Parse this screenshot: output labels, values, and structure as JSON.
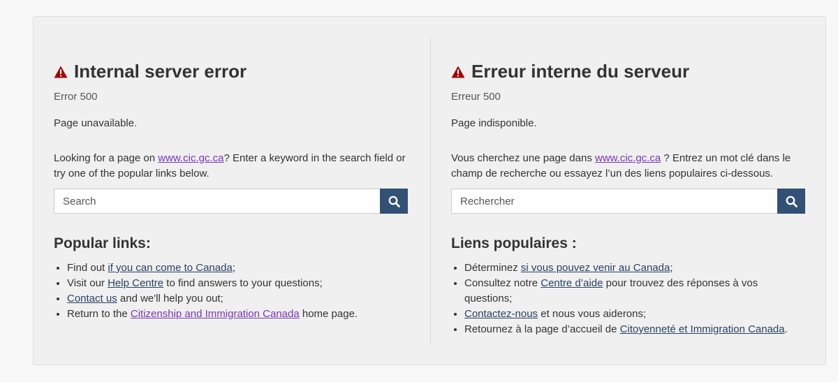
{
  "en": {
    "title": "Internal server error",
    "code": "Error 500",
    "unavailable": "Page unavailable.",
    "intro_before": "Looking for a page on ",
    "intro_link": "www.cic.gc.ca",
    "intro_after": "? Enter a keyword in the search field or try one of the popular links below.",
    "search_placeholder": "Search",
    "popular_heading": "Popular links:",
    "links": [
      {
        "before": "Find out ",
        "link": "if you can come to Canada",
        "after": ";"
      },
      {
        "before": "Visit our ",
        "link": "Help Centre",
        "after": " to find answers to your questions;"
      },
      {
        "before": "",
        "link": "Contact us",
        "after": " and we'll help you out;"
      },
      {
        "before": "Return to the ",
        "link": "Citizenship and Immigration Canada",
        "after": " home page."
      }
    ]
  },
  "fr": {
    "title": "Erreur interne du serveur",
    "code": "Erreur 500",
    "unavailable": "Page indisponible.",
    "intro_before": "Vous cherchez une page dans ",
    "intro_link": "www.cic.gc.ca",
    "intro_after": " ? Entrez un mot clé dans le champ de recherche ou essayez l’un des liens populaires ci-dessous.",
    "search_placeholder": "Rechercher",
    "popular_heading": "Liens populaires :",
    "links": [
      {
        "before": "Déterminez ",
        "link": "si vous pouvez venir au Canada",
        "after": ";"
      },
      {
        "before": "Consultez notre ",
        "link": "Centre d’aide",
        "after": " pour trouvez des réponses à vos questions;"
      },
      {
        "before": "",
        "link": "Contactez-nous",
        "after": " et nous vous aiderons;"
      },
      {
        "before": "Retournez à la page d’accueil de ",
        "link": "Citoyenneté et Immigration Canada",
        "after": "."
      }
    ]
  },
  "icons": {
    "warning": "warning-icon",
    "search": "search-icon"
  },
  "colors": {
    "warning": "#a60000",
    "link": "#284162",
    "visited_link": "#7834bc",
    "search_button": "#335075"
  }
}
